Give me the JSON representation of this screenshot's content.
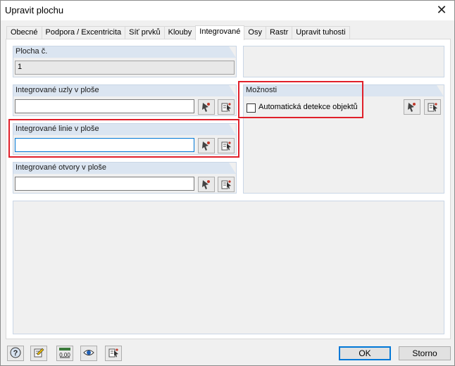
{
  "window": {
    "title": "Upravit plochu",
    "close_glyph": "✕"
  },
  "tabs": [
    {
      "label": "Obecné"
    },
    {
      "label": "Podpora / Excentricita"
    },
    {
      "label": "Síť prvků"
    },
    {
      "label": "Klouby"
    },
    {
      "label": "Integrované",
      "active": true
    },
    {
      "label": "Osy"
    },
    {
      "label": "Rastr"
    },
    {
      "label": "Upravit tuhosti"
    }
  ],
  "plocha": {
    "header": "Plocha č.",
    "value": "1"
  },
  "uzly": {
    "header": "Integrované uzly v ploše",
    "value": ""
  },
  "linie": {
    "header": "Integrované linie v ploše",
    "value": ""
  },
  "otvory": {
    "header": "Integrované otvory v ploše",
    "value": ""
  },
  "moznosti": {
    "header": "Možnosti",
    "checkbox_label": "Automatická detekce objektů",
    "checked": false
  },
  "buttons": {
    "ok": "OK",
    "cancel": "Storno"
  },
  "toolbar_icons": [
    "help-icon",
    "edit-icon",
    "units-icon",
    "view-icon",
    "select-icon"
  ],
  "units_icon_text": "0,00",
  "colors": {
    "highlight": "#e0202a",
    "group_header": "#dbe5f1",
    "accent": "#0078d7"
  }
}
